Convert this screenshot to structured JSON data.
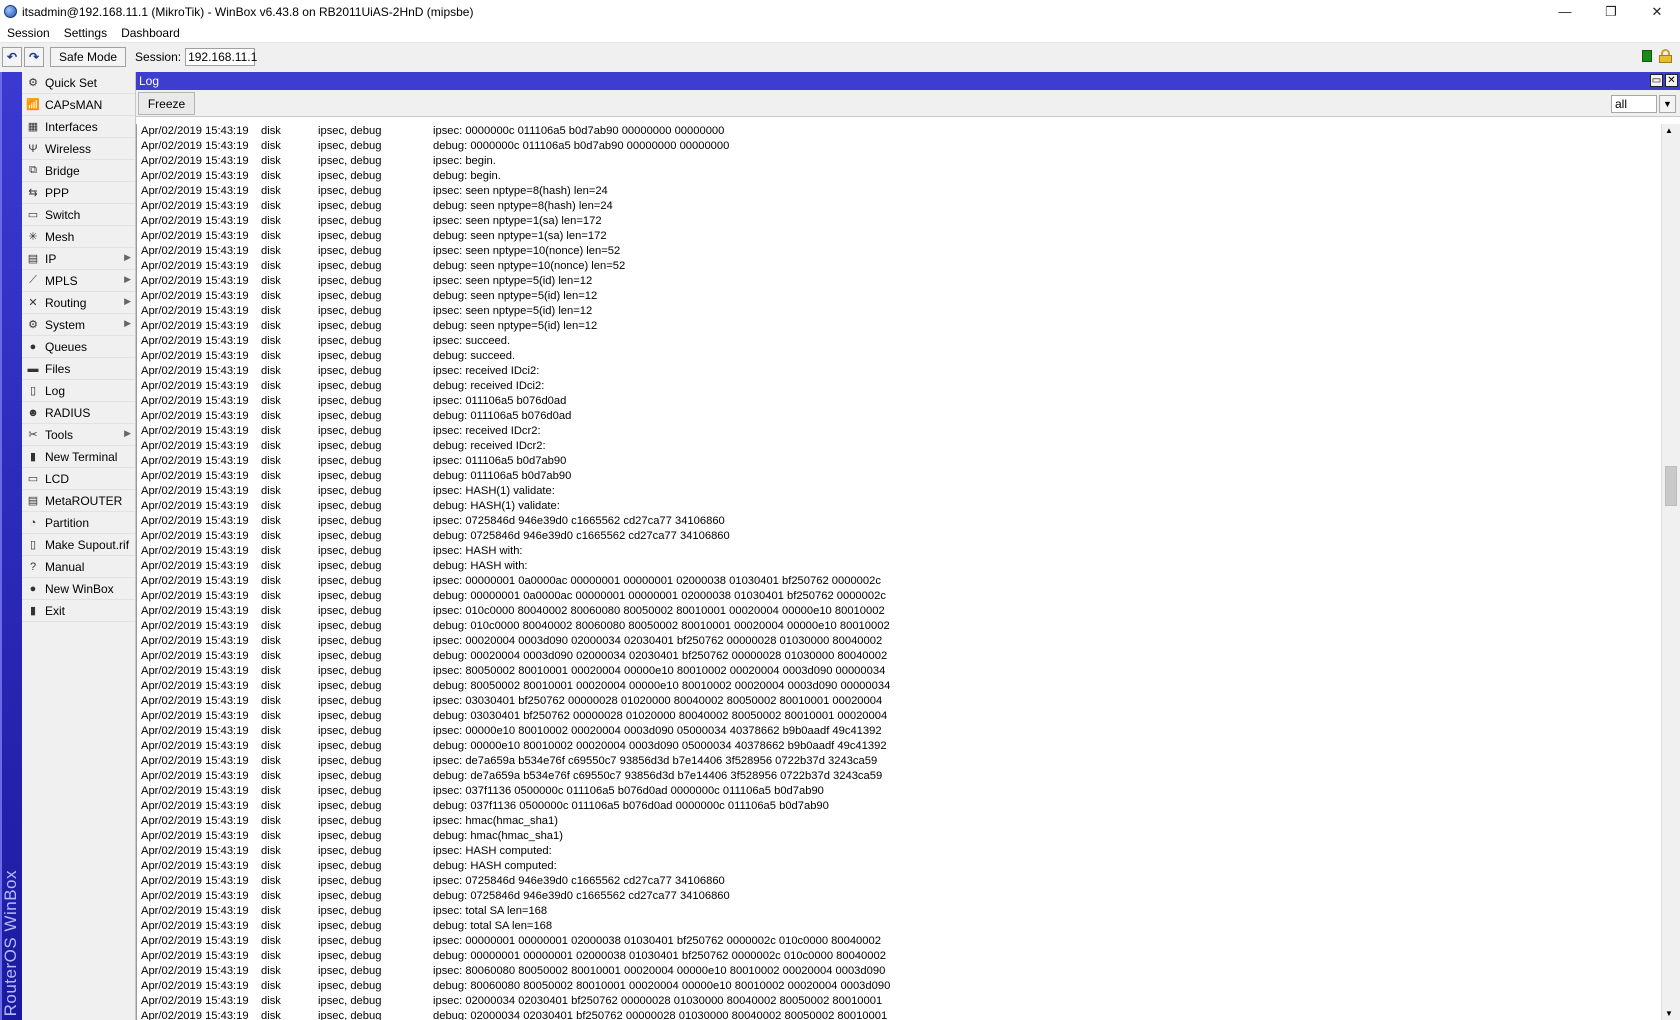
{
  "window": {
    "title": "itsadmin@192.168.11.1 (MikroTik) - WinBox v6.43.8 on RB2011UiAS-2HnD (mipsbe)",
    "controls": [
      "—",
      "❐",
      "✕"
    ]
  },
  "menubar": {
    "items": [
      "Session",
      "Settings",
      "Dashboard"
    ]
  },
  "toolbar": {
    "undo": "↶",
    "redo": "↷",
    "safe_mode": "Safe Mode",
    "session_label": "Session:",
    "session_value": "192.168.11.1"
  },
  "brand": "RouterOS WinBox",
  "sidebar": {
    "items": [
      {
        "label": "Quick Set",
        "icon": "quick-set-icon",
        "glyph": "⚙",
        "submenu": false
      },
      {
        "label": "CAPsMAN",
        "icon": "capsman-icon",
        "glyph": "📶",
        "submenu": false
      },
      {
        "label": "Interfaces",
        "icon": "interfaces-icon",
        "glyph": "▦",
        "submenu": false
      },
      {
        "label": "Wireless",
        "icon": "wireless-icon",
        "glyph": "Ψ",
        "submenu": false
      },
      {
        "label": "Bridge",
        "icon": "bridge-icon",
        "glyph": "⧉",
        "submenu": false
      },
      {
        "label": "PPP",
        "icon": "ppp-icon",
        "glyph": "⇆",
        "submenu": false
      },
      {
        "label": "Switch",
        "icon": "switch-icon",
        "glyph": "▭",
        "submenu": false
      },
      {
        "label": "Mesh",
        "icon": "mesh-icon",
        "glyph": "✳",
        "submenu": false
      },
      {
        "label": "IP",
        "icon": "ip-icon",
        "glyph": "▤",
        "submenu": true
      },
      {
        "label": "MPLS",
        "icon": "mpls-icon",
        "glyph": "⟋",
        "submenu": true
      },
      {
        "label": "Routing",
        "icon": "routing-icon",
        "glyph": "✕",
        "submenu": true
      },
      {
        "label": "System",
        "icon": "system-icon",
        "glyph": "⚙",
        "submenu": true
      },
      {
        "label": "Queues",
        "icon": "queues-icon",
        "glyph": "●",
        "submenu": false
      },
      {
        "label": "Files",
        "icon": "files-icon",
        "glyph": "▬",
        "submenu": false
      },
      {
        "label": "Log",
        "icon": "log-icon",
        "glyph": "▯",
        "submenu": false
      },
      {
        "label": "RADIUS",
        "icon": "radius-icon",
        "glyph": "☻",
        "submenu": false
      },
      {
        "label": "Tools",
        "icon": "tools-icon",
        "glyph": "✂",
        "submenu": true
      },
      {
        "label": "New Terminal",
        "icon": "terminal-icon",
        "glyph": "▮",
        "submenu": false
      },
      {
        "label": "LCD",
        "icon": "lcd-icon",
        "glyph": "▭",
        "submenu": false
      },
      {
        "label": "MetaROUTER",
        "icon": "metarouter-icon",
        "glyph": "▤",
        "submenu": false
      },
      {
        "label": "Partition",
        "icon": "partition-icon",
        "glyph": "◔",
        "submenu": false
      },
      {
        "label": "Make Supout.rif",
        "icon": "supout-icon",
        "glyph": "▯",
        "submenu": false
      },
      {
        "label": "Manual",
        "icon": "manual-icon",
        "glyph": "?",
        "submenu": false
      },
      {
        "label": "New WinBox",
        "icon": "winbox-icon",
        "glyph": "●",
        "submenu": false
      },
      {
        "label": "Exit",
        "icon": "exit-icon",
        "glyph": "▮",
        "submenu": false
      }
    ]
  },
  "log_window": {
    "title": "Log",
    "freeze_label": "Freeze",
    "filter_value": "all",
    "rows": [
      {
        "time": "Apr/02/2019 15:43:19",
        "buffer": "disk",
        "topics": "ipsec, debug",
        "message": "ipsec: 0000000c 011106a5 b0d7ab90 00000000 00000000"
      },
      {
        "time": "Apr/02/2019 15:43:19",
        "buffer": "disk",
        "topics": "ipsec, debug",
        "message": "debug: 0000000c 011106a5 b0d7ab90 00000000 00000000"
      },
      {
        "time": "Apr/02/2019 15:43:19",
        "buffer": "disk",
        "topics": "ipsec, debug",
        "message": "ipsec: begin."
      },
      {
        "time": "Apr/02/2019 15:43:19",
        "buffer": "disk",
        "topics": "ipsec, debug",
        "message": "debug: begin."
      },
      {
        "time": "Apr/02/2019 15:43:19",
        "buffer": "disk",
        "topics": "ipsec, debug",
        "message": "ipsec: seen nptype=8(hash) len=24"
      },
      {
        "time": "Apr/02/2019 15:43:19",
        "buffer": "disk",
        "topics": "ipsec, debug",
        "message": "debug: seen nptype=8(hash) len=24"
      },
      {
        "time": "Apr/02/2019 15:43:19",
        "buffer": "disk",
        "topics": "ipsec, debug",
        "message": "ipsec: seen nptype=1(sa) len=172"
      },
      {
        "time": "Apr/02/2019 15:43:19",
        "buffer": "disk",
        "topics": "ipsec, debug",
        "message": "debug: seen nptype=1(sa) len=172"
      },
      {
        "time": "Apr/02/2019 15:43:19",
        "buffer": "disk",
        "topics": "ipsec, debug",
        "message": "ipsec: seen nptype=10(nonce) len=52"
      },
      {
        "time": "Apr/02/2019 15:43:19",
        "buffer": "disk",
        "topics": "ipsec, debug",
        "message": "debug: seen nptype=10(nonce) len=52"
      },
      {
        "time": "Apr/02/2019 15:43:19",
        "buffer": "disk",
        "topics": "ipsec, debug",
        "message": "ipsec: seen nptype=5(id) len=12"
      },
      {
        "time": "Apr/02/2019 15:43:19",
        "buffer": "disk",
        "topics": "ipsec, debug",
        "message": "debug: seen nptype=5(id) len=12"
      },
      {
        "time": "Apr/02/2019 15:43:19",
        "buffer": "disk",
        "topics": "ipsec, debug",
        "message": "ipsec: seen nptype=5(id) len=12"
      },
      {
        "time": "Apr/02/2019 15:43:19",
        "buffer": "disk",
        "topics": "ipsec, debug",
        "message": "debug: seen nptype=5(id) len=12"
      },
      {
        "time": "Apr/02/2019 15:43:19",
        "buffer": "disk",
        "topics": "ipsec, debug",
        "message": "ipsec: succeed."
      },
      {
        "time": "Apr/02/2019 15:43:19",
        "buffer": "disk",
        "topics": "ipsec, debug",
        "message": "debug: succeed."
      },
      {
        "time": "Apr/02/2019 15:43:19",
        "buffer": "disk",
        "topics": "ipsec, debug",
        "message": "ipsec: received IDci2:"
      },
      {
        "time": "Apr/02/2019 15:43:19",
        "buffer": "disk",
        "topics": "ipsec, debug",
        "message": "debug: received IDci2:"
      },
      {
        "time": "Apr/02/2019 15:43:19",
        "buffer": "disk",
        "topics": "ipsec, debug",
        "message": "ipsec: 011106a5 b076d0ad"
      },
      {
        "time": "Apr/02/2019 15:43:19",
        "buffer": "disk",
        "topics": "ipsec, debug",
        "message": "debug: 011106a5 b076d0ad"
      },
      {
        "time": "Apr/02/2019 15:43:19",
        "buffer": "disk",
        "topics": "ipsec, debug",
        "message": "ipsec: received IDcr2:"
      },
      {
        "time": "Apr/02/2019 15:43:19",
        "buffer": "disk",
        "topics": "ipsec, debug",
        "message": "debug: received IDcr2:"
      },
      {
        "time": "Apr/02/2019 15:43:19",
        "buffer": "disk",
        "topics": "ipsec, debug",
        "message": "ipsec: 011106a5 b0d7ab90"
      },
      {
        "time": "Apr/02/2019 15:43:19",
        "buffer": "disk",
        "topics": "ipsec, debug",
        "message": "debug: 011106a5 b0d7ab90"
      },
      {
        "time": "Apr/02/2019 15:43:19",
        "buffer": "disk",
        "topics": "ipsec, debug",
        "message": "ipsec: HASH(1) validate:"
      },
      {
        "time": "Apr/02/2019 15:43:19",
        "buffer": "disk",
        "topics": "ipsec, debug",
        "message": "debug: HASH(1) validate:"
      },
      {
        "time": "Apr/02/2019 15:43:19",
        "buffer": "disk",
        "topics": "ipsec, debug",
        "message": "ipsec: 0725846d 946e39d0 c1665562 cd27ca77 34106860"
      },
      {
        "time": "Apr/02/2019 15:43:19",
        "buffer": "disk",
        "topics": "ipsec, debug",
        "message": "debug: 0725846d 946e39d0 c1665562 cd27ca77 34106860"
      },
      {
        "time": "Apr/02/2019 15:43:19",
        "buffer": "disk",
        "topics": "ipsec, debug",
        "message": "ipsec: HASH with:"
      },
      {
        "time": "Apr/02/2019 15:43:19",
        "buffer": "disk",
        "topics": "ipsec, debug",
        "message": "debug: HASH with:"
      },
      {
        "time": "Apr/02/2019 15:43:19",
        "buffer": "disk",
        "topics": "ipsec, debug",
        "message": "ipsec: 00000001 0a0000ac 00000001 00000001 02000038 01030401 bf250762 0000002c"
      },
      {
        "time": "Apr/02/2019 15:43:19",
        "buffer": "disk",
        "topics": "ipsec, debug",
        "message": "debug: 00000001 0a0000ac 00000001 00000001 02000038 01030401 bf250762 0000002c"
      },
      {
        "time": "Apr/02/2019 15:43:19",
        "buffer": "disk",
        "topics": "ipsec, debug",
        "message": "ipsec: 010c0000 80040002 80060080 80050002 80010001 00020004 00000e10 80010002"
      },
      {
        "time": "Apr/02/2019 15:43:19",
        "buffer": "disk",
        "topics": "ipsec, debug",
        "message": "debug: 010c0000 80040002 80060080 80050002 80010001 00020004 00000e10 80010002"
      },
      {
        "time": "Apr/02/2019 15:43:19",
        "buffer": "disk",
        "topics": "ipsec, debug",
        "message": "ipsec: 00020004 0003d090 02000034 02030401 bf250762 00000028 01030000 80040002"
      },
      {
        "time": "Apr/02/2019 15:43:19",
        "buffer": "disk",
        "topics": "ipsec, debug",
        "message": "debug: 00020004 0003d090 02000034 02030401 bf250762 00000028 01030000 80040002"
      },
      {
        "time": "Apr/02/2019 15:43:19",
        "buffer": "disk",
        "topics": "ipsec, debug",
        "message": "ipsec: 80050002 80010001 00020004 00000e10 80010002 00020004 0003d090 00000034"
      },
      {
        "time": "Apr/02/2019 15:43:19",
        "buffer": "disk",
        "topics": "ipsec, debug",
        "message": "debug: 80050002 80010001 00020004 00000e10 80010002 00020004 0003d090 00000034"
      },
      {
        "time": "Apr/02/2019 15:43:19",
        "buffer": "disk",
        "topics": "ipsec, debug",
        "message": "ipsec: 03030401 bf250762 00000028 01020000 80040002 80050002 80010001 00020004"
      },
      {
        "time": "Apr/02/2019 15:43:19",
        "buffer": "disk",
        "topics": "ipsec, debug",
        "message": "debug: 03030401 bf250762 00000028 01020000 80040002 80050002 80010001 00020004"
      },
      {
        "time": "Apr/02/2019 15:43:19",
        "buffer": "disk",
        "topics": "ipsec, debug",
        "message": "ipsec: 00000e10 80010002 00020004 0003d090 05000034 40378662 b9b0aadf 49c41392"
      },
      {
        "time": "Apr/02/2019 15:43:19",
        "buffer": "disk",
        "topics": "ipsec, debug",
        "message": "debug: 00000e10 80010002 00020004 0003d090 05000034 40378662 b9b0aadf 49c41392"
      },
      {
        "time": "Apr/02/2019 15:43:19",
        "buffer": "disk",
        "topics": "ipsec, debug",
        "message": "ipsec: de7a659a b534e76f c69550c7 93856d3d b7e14406 3f528956 0722b37d 3243ca59"
      },
      {
        "time": "Apr/02/2019 15:43:19",
        "buffer": "disk",
        "topics": "ipsec, debug",
        "message": "debug: de7a659a b534e76f c69550c7 93856d3d b7e14406 3f528956 0722b37d 3243ca59"
      },
      {
        "time": "Apr/02/2019 15:43:19",
        "buffer": "disk",
        "topics": "ipsec, debug",
        "message": "ipsec: 037f1136 0500000c 011106a5 b076d0ad 0000000c 011106a5 b0d7ab90"
      },
      {
        "time": "Apr/02/2019 15:43:19",
        "buffer": "disk",
        "topics": "ipsec, debug",
        "message": "debug: 037f1136 0500000c 011106a5 b076d0ad 0000000c 011106a5 b0d7ab90"
      },
      {
        "time": "Apr/02/2019 15:43:19",
        "buffer": "disk",
        "topics": "ipsec, debug",
        "message": "ipsec: hmac(hmac_sha1)"
      },
      {
        "time": "Apr/02/2019 15:43:19",
        "buffer": "disk",
        "topics": "ipsec, debug",
        "message": "debug: hmac(hmac_sha1)"
      },
      {
        "time": "Apr/02/2019 15:43:19",
        "buffer": "disk",
        "topics": "ipsec, debug",
        "message": "ipsec: HASH computed:"
      },
      {
        "time": "Apr/02/2019 15:43:19",
        "buffer": "disk",
        "topics": "ipsec, debug",
        "message": "debug: HASH computed:"
      },
      {
        "time": "Apr/02/2019 15:43:19",
        "buffer": "disk",
        "topics": "ipsec, debug",
        "message": "ipsec: 0725846d 946e39d0 c1665562 cd27ca77 34106860"
      },
      {
        "time": "Apr/02/2019 15:43:19",
        "buffer": "disk",
        "topics": "ipsec, debug",
        "message": "debug: 0725846d 946e39d0 c1665562 cd27ca77 34106860"
      },
      {
        "time": "Apr/02/2019 15:43:19",
        "buffer": "disk",
        "topics": "ipsec, debug",
        "message": "ipsec: total SA len=168"
      },
      {
        "time": "Apr/02/2019 15:43:19",
        "buffer": "disk",
        "topics": "ipsec, debug",
        "message": "debug: total SA len=168"
      },
      {
        "time": "Apr/02/2019 15:43:19",
        "buffer": "disk",
        "topics": "ipsec, debug",
        "message": "ipsec: 00000001 00000001 02000038 01030401 bf250762 0000002c 010c0000 80040002"
      },
      {
        "time": "Apr/02/2019 15:43:19",
        "buffer": "disk",
        "topics": "ipsec, debug",
        "message": "debug: 00000001 00000001 02000038 01030401 bf250762 0000002c 010c0000 80040002"
      },
      {
        "time": "Apr/02/2019 15:43:19",
        "buffer": "disk",
        "topics": "ipsec, debug",
        "message": "ipsec: 80060080 80050002 80010001 00020004 00000e10 80010002 00020004 0003d090"
      },
      {
        "time": "Apr/02/2019 15:43:19",
        "buffer": "disk",
        "topics": "ipsec, debug",
        "message": "debug: 80060080 80050002 80010001 00020004 00000e10 80010002 00020004 0003d090"
      },
      {
        "time": "Apr/02/2019 15:43:19",
        "buffer": "disk",
        "topics": "ipsec, debug",
        "message": "ipsec: 02000034 02030401 bf250762 00000028 01030000 80040002 80050002 80010001"
      },
      {
        "time": "Apr/02/2019 15:43:19",
        "buffer": "disk",
        "topics": "ipsec, debug",
        "message": "debug: 02000034 02030401 bf250762 00000028 01030000 80040002 80050002 80010001"
      }
    ]
  }
}
